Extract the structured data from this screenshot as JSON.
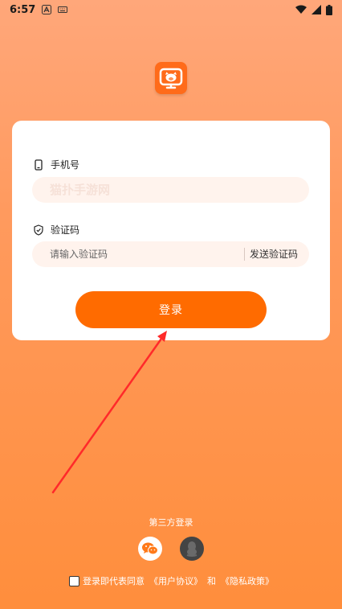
{
  "status_bar": {
    "time": "6:57"
  },
  "login_card": {
    "phone_label": "手机号",
    "phone_placeholder": "猫扑手游网",
    "code_label": "验证码",
    "code_placeholder": "请输入验证码",
    "send_code": "发送验证码",
    "login_button": "登录"
  },
  "third_party": {
    "label": "第三方登录"
  },
  "agreement": {
    "prefix": "登录即代表同意",
    "user_agreement": "《用户协议》",
    "and": "和",
    "privacy_policy": "《隐私政策》"
  },
  "colors": {
    "accent": "#ff6b00",
    "background_top": "#ffa77a",
    "background_bottom": "#ff8e3c",
    "input_background": "#fff3ed",
    "arrow": "#ff2a2a"
  }
}
